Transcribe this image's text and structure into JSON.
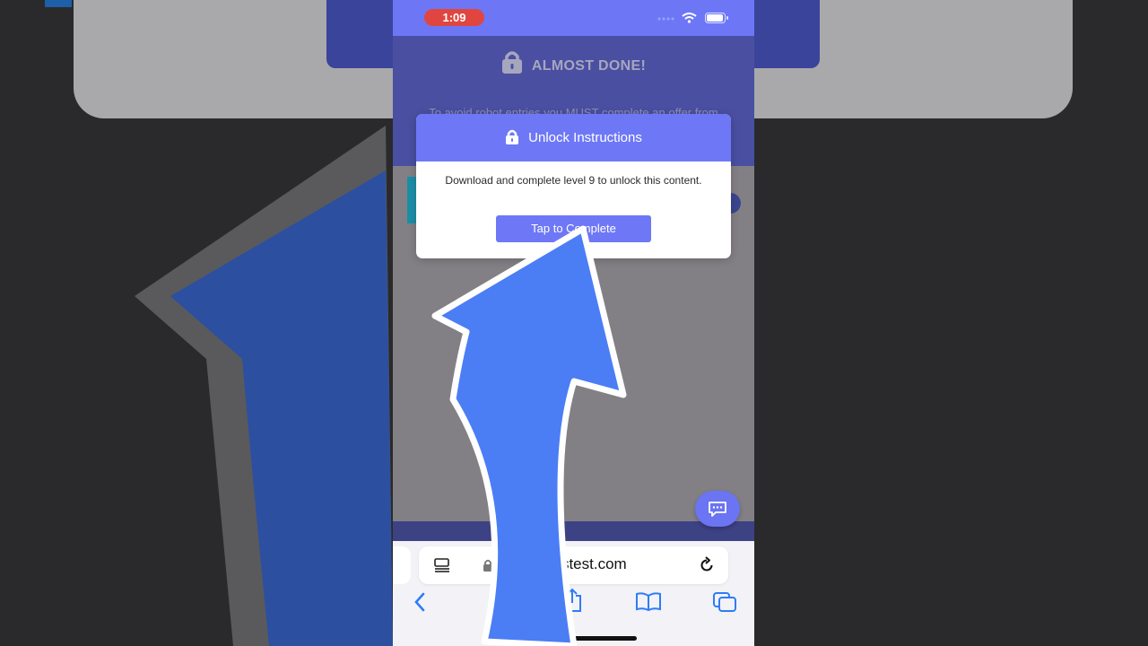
{
  "status_bar": {
    "time": "1:09"
  },
  "page": {
    "heading": "ALMOST DONE!",
    "description_line": "To avoid robot entries you MUST complete an offer from"
  },
  "modal": {
    "title": "Unlock Instructions",
    "body": "Download and complete level 9 to unlock this content.",
    "button_label": "Tap to Complete"
  },
  "browser": {
    "url": "cl       serstest.com",
    "toolbar_icons": [
      "back-icon",
      "forward-icon",
      "share-icon",
      "bookmarks-icon",
      "tabs-icon"
    ]
  },
  "colors": {
    "accent": "#6e78f6",
    "header_dark": "#4a4fa1",
    "recording_pill": "#e0463f",
    "overlay_arrow": "#4b7df5"
  }
}
